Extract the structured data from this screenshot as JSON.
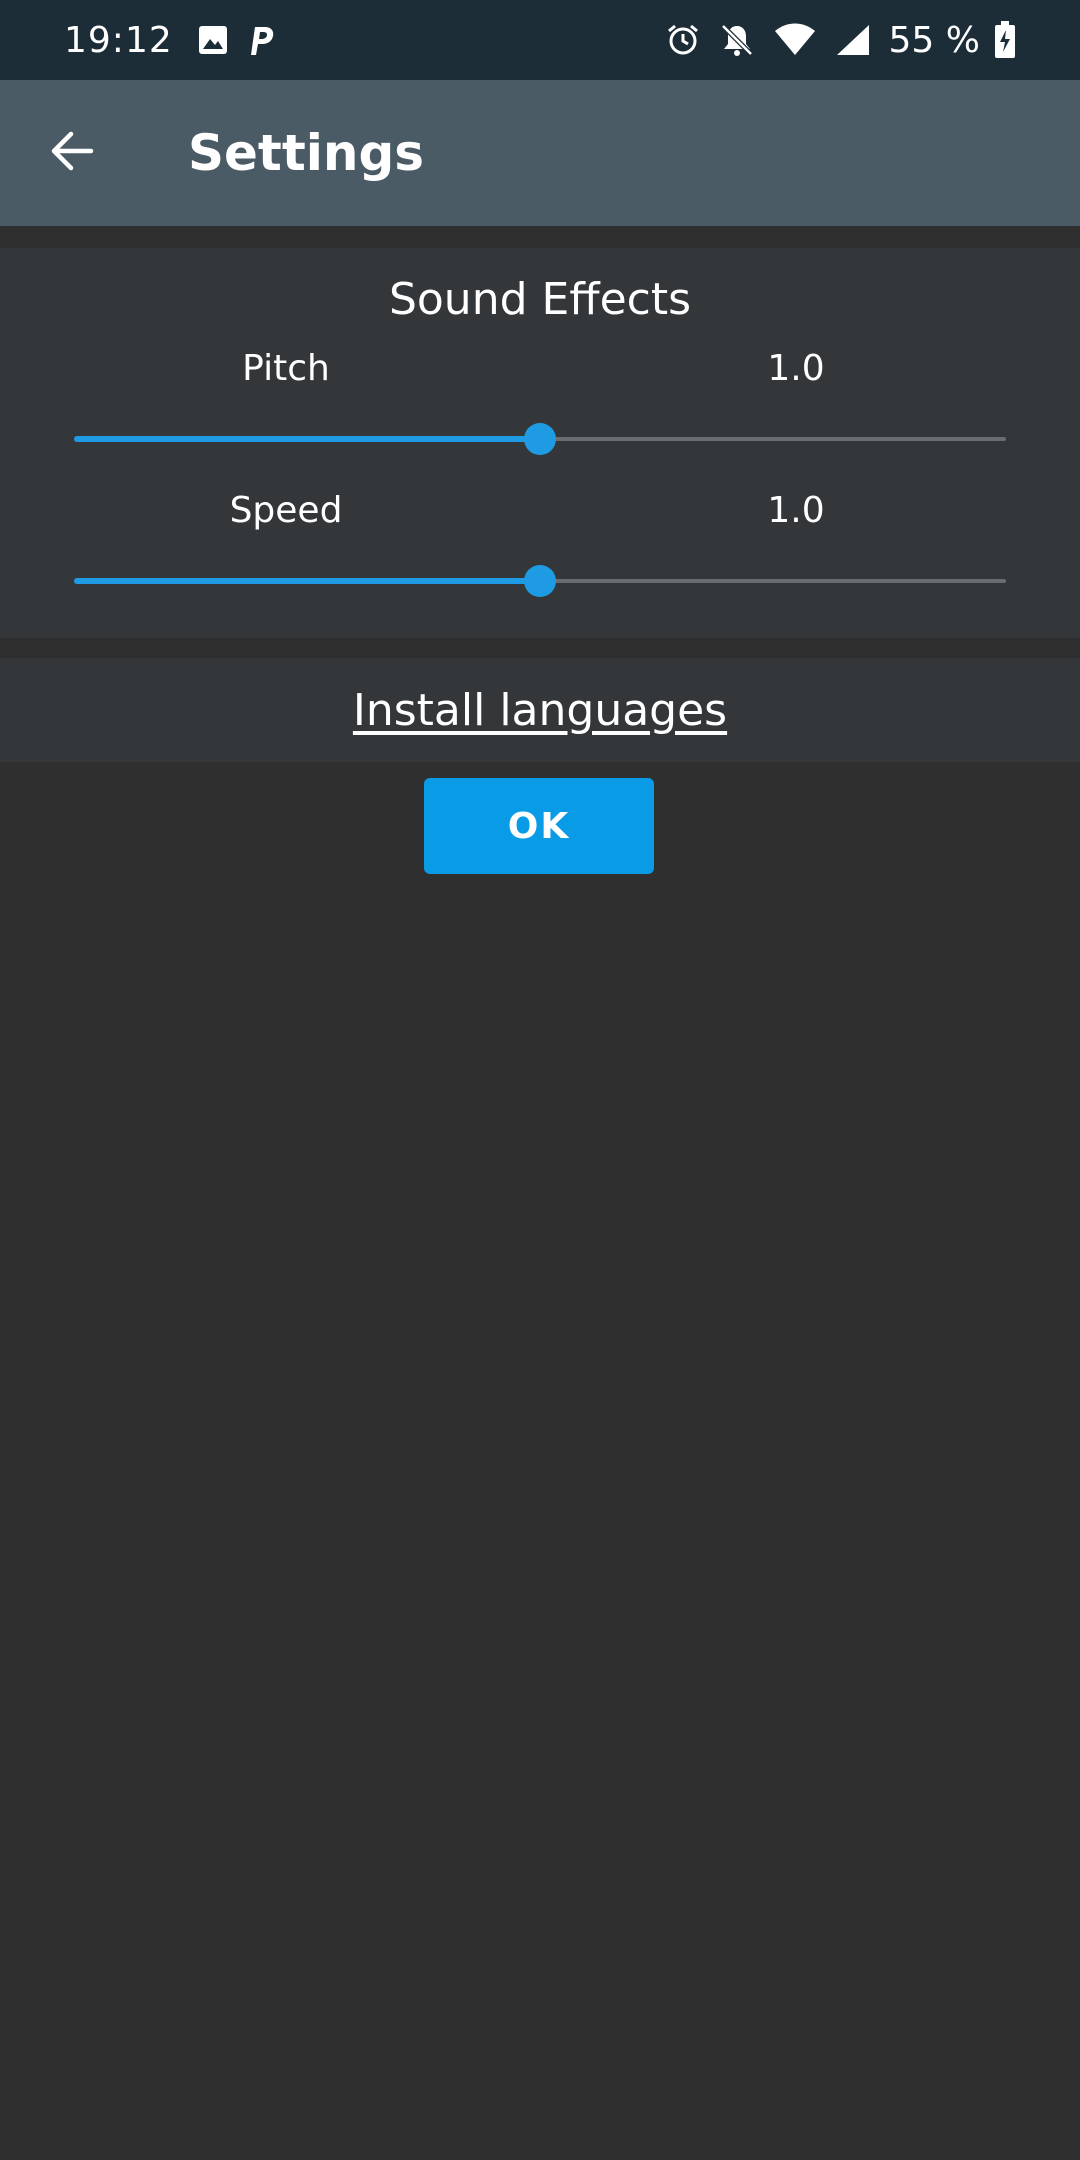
{
  "status_bar": {
    "time": "19:12",
    "battery": "55 %",
    "left_icons": [
      "image-icon",
      "parking-app-icon"
    ],
    "right_icons": [
      "alarm-icon",
      "bell-off-icon",
      "wifi-icon",
      "signal-icon",
      "battery-charging-icon"
    ]
  },
  "app_bar": {
    "title": "Settings",
    "back_icon": "arrow-left-icon"
  },
  "sound_effects": {
    "title": "Sound Effects",
    "pitch": {
      "label": "Pitch",
      "value": "1.0",
      "level": 0.5
    },
    "speed": {
      "label": "Speed",
      "value": "1.0",
      "level": 0.5
    }
  },
  "install_languages": {
    "label": "Install languages"
  },
  "ok_button": {
    "label": "OK"
  },
  "colors": {
    "status_bar_bg": "#1c2d38",
    "app_bar_bg": "#4b5b66",
    "page_bg": "#2f2f2f",
    "panel_bg": "#33373a",
    "accent": "#0a9be6"
  }
}
